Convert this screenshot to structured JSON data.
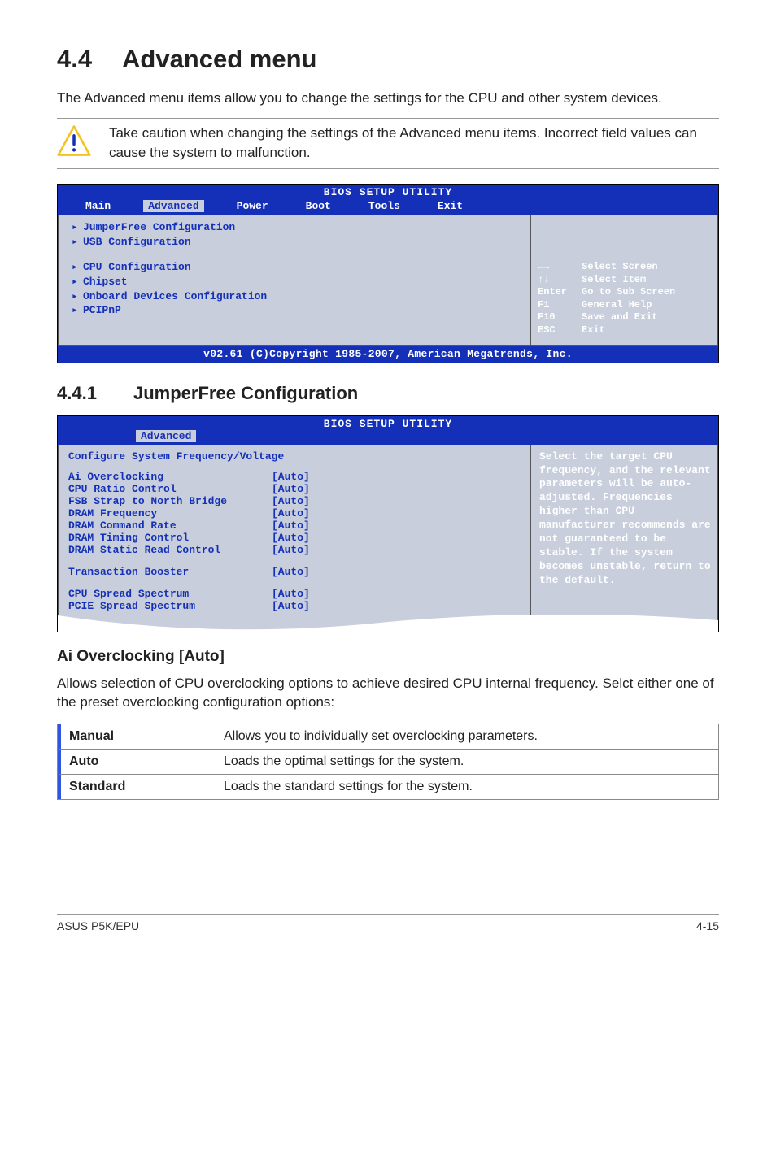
{
  "section": {
    "number": "4.4",
    "title": "Advanced menu",
    "intro": "The Advanced menu items allow you to change the settings for the CPU and other system devices.",
    "caution": "Take caution when changing the settings of the Advanced menu items. Incorrect field values can cause the system to malfunction."
  },
  "bios1": {
    "header": "BIOS SETUP UTILITY",
    "tabs": [
      "Main",
      "Advanced",
      "Power",
      "Boot",
      "Tools",
      "Exit"
    ],
    "active_tab": "Advanced",
    "group1": [
      "JumperFree Configuration",
      "USB Configuration"
    ],
    "group2": [
      "CPU Configuration",
      "Chipset",
      "Onboard Devices Configuration",
      "PCIPnP"
    ],
    "legend": [
      {
        "key": "←→",
        "text": "Select Screen"
      },
      {
        "key": "↑↓",
        "text": "Select Item"
      },
      {
        "key": "Enter",
        "text": "Go to Sub Screen"
      },
      {
        "key": "F1",
        "text": "General Help"
      },
      {
        "key": "F10",
        "text": "Save and Exit"
      },
      {
        "key": "ESC",
        "text": "Exit"
      }
    ],
    "footer": "v02.61 (C)Copyright 1985-2007, American Megatrends, Inc."
  },
  "subsection": {
    "number": "4.4.1",
    "title": "JumperFree Configuration"
  },
  "bios2": {
    "header": "BIOS SETUP UTILITY",
    "tab": "Advanced",
    "panel_title": "Configure System Frequency/Voltage",
    "items": [
      {
        "label": "Ai Overclocking",
        "value": "[Auto]"
      },
      {
        "label": "CPU Ratio Control",
        "value": "[Auto]"
      },
      {
        "label": "FSB Strap to North Bridge",
        "value": "[Auto]"
      },
      {
        "label": "DRAM Frequency",
        "value": "[Auto]"
      },
      {
        "label": "DRAM Command Rate",
        "value": "[Auto]"
      },
      {
        "label": "DRAM Timing Control",
        "value": "[Auto]"
      },
      {
        "label": "DRAM Static Read Control",
        "value": "[Auto]"
      }
    ],
    "items2": [
      {
        "label": "Transaction Booster",
        "value": "[Auto]"
      }
    ],
    "items3": [
      {
        "label": "CPU Spread Spectrum",
        "value": "[Auto]"
      },
      {
        "label": "PCIE Spread Spectrum",
        "value": "[Auto]"
      }
    ],
    "help": "Select the target CPU frequency, and the relevant parameters will be auto-adjusted. Frequencies higher than CPU manufacturer recommends are not guaranteed to be stable. If the system becomes unstable, return to the default."
  },
  "option": {
    "title": "Ai Overclocking [Auto]",
    "text": "Allows selection of CPU overclocking options to achieve desired CPU internal frequency. Selct either one of the preset overclocking configuration options:"
  },
  "opt_table": [
    {
      "key": "Manual",
      "desc": "Allows you to individually set overclocking parameters."
    },
    {
      "key": "Auto",
      "desc": "Loads the optimal settings for the system."
    },
    {
      "key": "Standard",
      "desc": "Loads the standard settings for the system."
    }
  ],
  "footer": {
    "left": "ASUS P5K/EPU",
    "right": "4-15"
  }
}
